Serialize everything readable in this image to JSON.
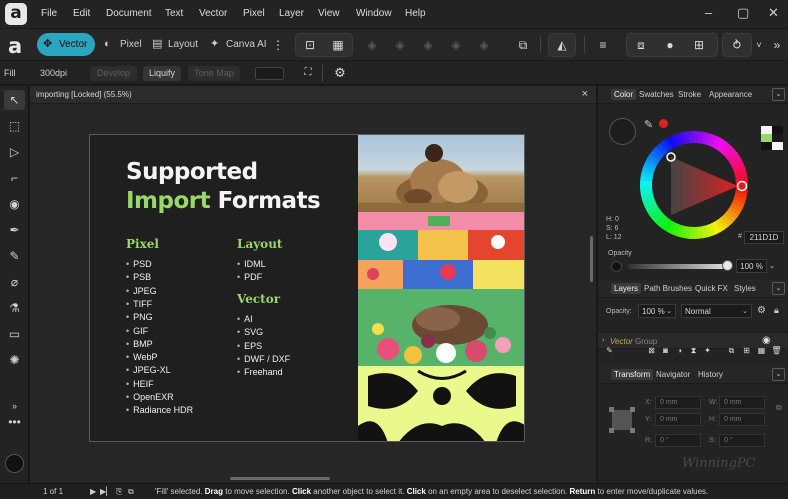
{
  "menu": {
    "items": [
      "File",
      "Edit",
      "Document",
      "Text",
      "Vector",
      "Pixel",
      "Layer",
      "View",
      "Window",
      "Help"
    ],
    "window_controls": [
      "–",
      "▢",
      "✕"
    ]
  },
  "toolbar": {
    "personas": [
      {
        "label": "Vector",
        "icon": "vector-persona-icon"
      },
      {
        "label": "Pixel",
        "icon": "pixel-persona-icon"
      },
      {
        "label": "Layout",
        "icon": "layout-persona-icon"
      },
      {
        "label": "Canva AI",
        "icon": "canva-ai-icon"
      }
    ],
    "more_label": "»",
    "dropdown_label": "˅"
  },
  "context": {
    "fill_label": "Fill",
    "dpi_label": "300dpi",
    "develop_label": "Develop",
    "liquify_label": "Liquify",
    "tonemap_label": "Tone Map"
  },
  "document": {
    "tab_title": "importing [Locked] (55.5%)",
    "close_label": "×"
  },
  "artboard": {
    "title_line1": "Supported",
    "title_line2_highlight": "Import",
    "title_line2_rest": "Formats",
    "pixel_heading": "Pixel",
    "pixel_formats": [
      "PSD",
      "PSB",
      "JPEG",
      "TIFF",
      "PNG",
      "GIF",
      "BMP",
      "WebP",
      "JPEG-XL",
      "HEIF",
      "OpenEXR",
      "Radiance HDR"
    ],
    "layout_heading": "Layout",
    "layout_formats": [
      "IDML",
      "PDF"
    ],
    "vector_heading": "Vector",
    "vector_formats": [
      "AI",
      "SVG",
      "EPS",
      "DWF / DXF",
      "Freehand"
    ],
    "bullet": "•"
  },
  "color_panel": {
    "tabs": [
      "Color",
      "Swatches",
      "Stroke",
      "Appearance"
    ],
    "hsl": [
      {
        "label": "H: 0"
      },
      {
        "label": "S: 6"
      },
      {
        "label": "L: 12"
      }
    ],
    "hex_value": "211D1D",
    "opacity_label": "Opacity",
    "opacity_value": "100 %",
    "accent_color": "#e02020",
    "fill_color": "#211d1d"
  },
  "layers_panel": {
    "tabs": [
      "Layers",
      "Path Brushes",
      "Quick FX",
      "Styles"
    ],
    "opacity_label": "Opacity:",
    "opacity_value": "100 %",
    "blend_mode": "Normal",
    "layer_name": "Vector",
    "layer_type": "Group"
  },
  "transform_panel": {
    "tabs": [
      "Transform",
      "Navigator",
      "History"
    ],
    "fields": [
      {
        "label": "X:",
        "value": "0 mm"
      },
      {
        "label": "W:",
        "value": "0 mm"
      },
      {
        "label": "Y:",
        "value": "0 mm"
      },
      {
        "label": "H:",
        "value": "0 mm"
      },
      {
        "label": "R:",
        "value": "0 °"
      },
      {
        "label": "S:",
        "value": "0 °"
      }
    ]
  },
  "status": {
    "page": "1 of 1",
    "msg_a": "'Fill' selected.",
    "msg_b": "Drag",
    "msg_c": "to move selection.",
    "msg_d": "Click",
    "msg_e": "another object to select it.",
    "msg_f": "Click",
    "msg_g": "on an empty area to deselect selection.",
    "msg_h": "Return",
    "msg_i": "to enter move/duplicate values."
  }
}
